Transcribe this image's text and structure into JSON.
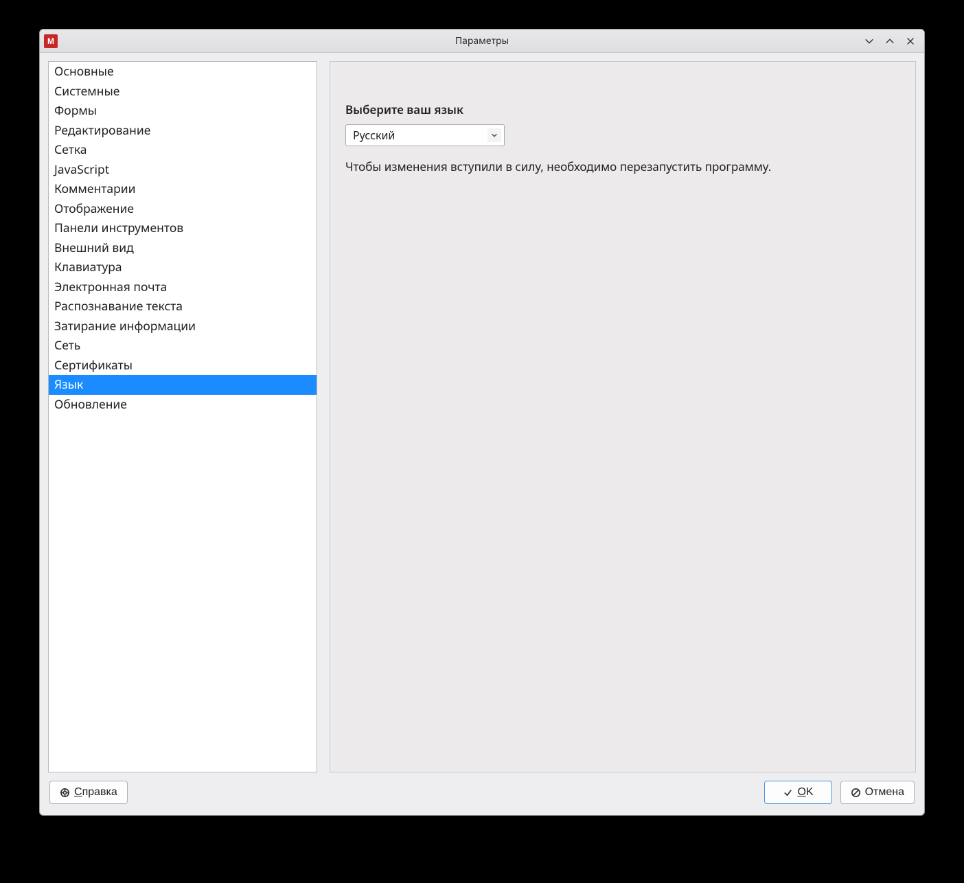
{
  "titlebar": {
    "title": "Параметры"
  },
  "sidebar": {
    "items": [
      {
        "label": "Основные"
      },
      {
        "label": "Системные"
      },
      {
        "label": "Формы"
      },
      {
        "label": "Редактирование"
      },
      {
        "label": "Сетка"
      },
      {
        "label": "JavaScript"
      },
      {
        "label": "Комментарии"
      },
      {
        "label": "Отображение"
      },
      {
        "label": "Панели инструментов"
      },
      {
        "label": "Внешний вид"
      },
      {
        "label": "Клавиатура"
      },
      {
        "label": "Электронная почта"
      },
      {
        "label": "Распознавание текста"
      },
      {
        "label": "Затирание информации"
      },
      {
        "label": "Сеть"
      },
      {
        "label": "Сертификаты"
      },
      {
        "label": "Язык",
        "selected": true
      },
      {
        "label": "Обновление"
      }
    ]
  },
  "content": {
    "language_label": "Выберите ваш язык",
    "language_value": "Русский",
    "restart_hint": "Чтобы изменения вступили в силу, необходимо перезапустить программу."
  },
  "footer": {
    "help_label": "Справка",
    "ok_label": "OK",
    "cancel_label": "Отмена"
  }
}
